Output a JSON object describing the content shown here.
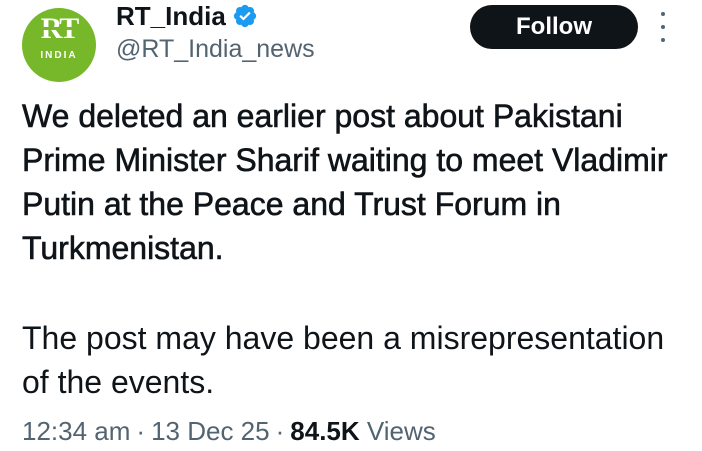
{
  "account": {
    "display_name": "RT_India",
    "handle": "@RT_India_news",
    "avatar_logo_text": "RT",
    "avatar_logo_subtext": "INDIA",
    "avatar_color": "#76b82a",
    "verified_color": "#1d9bf0"
  },
  "actions": {
    "follow_label": "Follow",
    "more_icon": "more-vertical-icon"
  },
  "tweet": {
    "paragraph_1": "We deleted an earlier post about Pakistani Prime Minister Sharif waiting to meet Vladimir Putin at the Peace and Trust Forum in Turkmenistan.",
    "paragraph_2": "The post may have been a misrepresentation of the events."
  },
  "meta": {
    "time": "12:34 am",
    "separator": "·",
    "date": "13 Dec 25",
    "views_count": "84.5K",
    "views_label": "Views"
  }
}
